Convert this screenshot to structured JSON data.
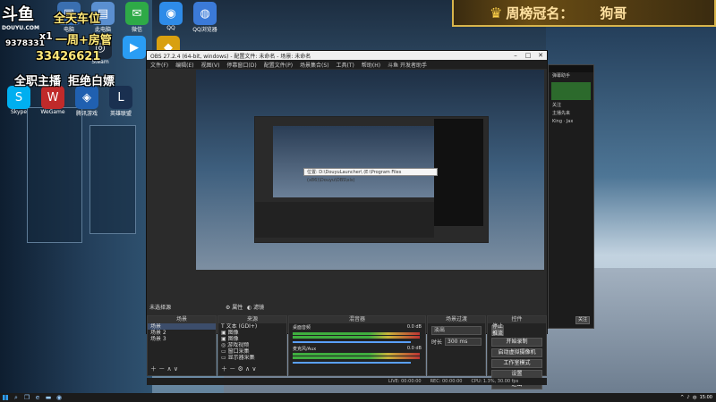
{
  "overlay": {
    "logo_text": "斗鱼",
    "logo_sub": "DOUYU.COM",
    "room_num_a": "9378331",
    "room_num_b": "33426621",
    "line1": "全天车位",
    "line2": "一周+房管",
    "line2_prefix": "x1",
    "line3_a": "全职主播",
    "line3_b": "拒绝白嫖"
  },
  "banner": {
    "label": "周榜冠名：",
    "name": "狗哥"
  },
  "desktop_icons": [
    {
      "label": "电脑",
      "glyph": "▣",
      "color": "#3a6fb0"
    },
    {
      "label": "此电脑",
      "glyph": "▤",
      "color": "#5a8fd0"
    },
    {
      "label": "微信",
      "glyph": "✉",
      "color": "#2eaa47"
    },
    {
      "label": "QQ",
      "glyph": "◉",
      "color": "#2e8be8"
    },
    {
      "label": "QQ浏览器",
      "glyph": "◍",
      "color": "#3b7ad8"
    }
  ],
  "desktop_icons_row2": [
    {
      "label": "Steam",
      "glyph": "◎",
      "color": "#1b2838"
    },
    {
      "label": "",
      "glyph": "▶",
      "color": "#2a9df4"
    },
    {
      "label": "",
      "glyph": "◆",
      "color": "#d8a010"
    }
  ],
  "desktop_icons_row3": [
    {
      "label": "Skype",
      "glyph": "S",
      "color": "#00aff0"
    },
    {
      "label": "WeGame",
      "glyph": "W",
      "color": "#c02a2a"
    },
    {
      "label": "腾讯游戏",
      "glyph": "◈",
      "color": "#2060b0"
    },
    {
      "label": "英雄联盟",
      "glyph": "L",
      "color": "#1a3050"
    }
  ],
  "obs": {
    "title": "OBS 27.2.4 (64-bit, windows) - 配置文件: 未命名 - 场景: 未命名",
    "menu": [
      "文件(F)",
      "编辑(E)",
      "视图(V)",
      "停靠窗口(D)",
      "配置文件(P)",
      "场景集合(S)",
      "工具(T)",
      "帮助(H)",
      "斗鱼 开发者助手"
    ],
    "address": "位置: D:\\DouyuLauncher\\ (E:\\Program Files (x86)\\Douyu\\OBS\\sls)",
    "source_bar": "未选择源",
    "source_bar_props": "属性",
    "source_bar_filters": "滤镜",
    "docks": {
      "scenes_title": "场景",
      "scenes": [
        "场景",
        "场景 2",
        "场景 3"
      ],
      "sources_title": "来源",
      "sources": [
        "文本 (GDI+)",
        "图像",
        "图像",
        "游戏视频",
        "窗口采集",
        "显示器采集"
      ],
      "mixer_title": "混音器",
      "mixer_a": "桌面音频",
      "mixer_a_db": "0.0 dB",
      "mixer_b": "麦克风/Aux",
      "mixer_b_db": "0.0 dB",
      "trans_title": "场景过渡",
      "trans_value": "淡出",
      "trans_dur_label": "时长",
      "trans_dur": "300 ms",
      "controls_title": "控件",
      "controls": [
        "停止推流",
        "开始录制",
        "启动虚拟摄像机",
        "工作室模式",
        "设置",
        "退出"
      ]
    },
    "status": [
      "LIVE: 00:00:00",
      "REC: 00:00:00",
      "CPU: 1.3%, 30.00 fps"
    ]
  },
  "chat": {
    "lines": [
      "弹幕助手",
      "",
      "",
      "",
      "关注",
      "",
      "主播先来",
      "",
      "",
      "King · Jax"
    ],
    "bottom": "关注"
  },
  "taskbar": {
    "time": "15:00",
    "tray": [
      "^",
      "♪",
      "中"
    ]
  }
}
